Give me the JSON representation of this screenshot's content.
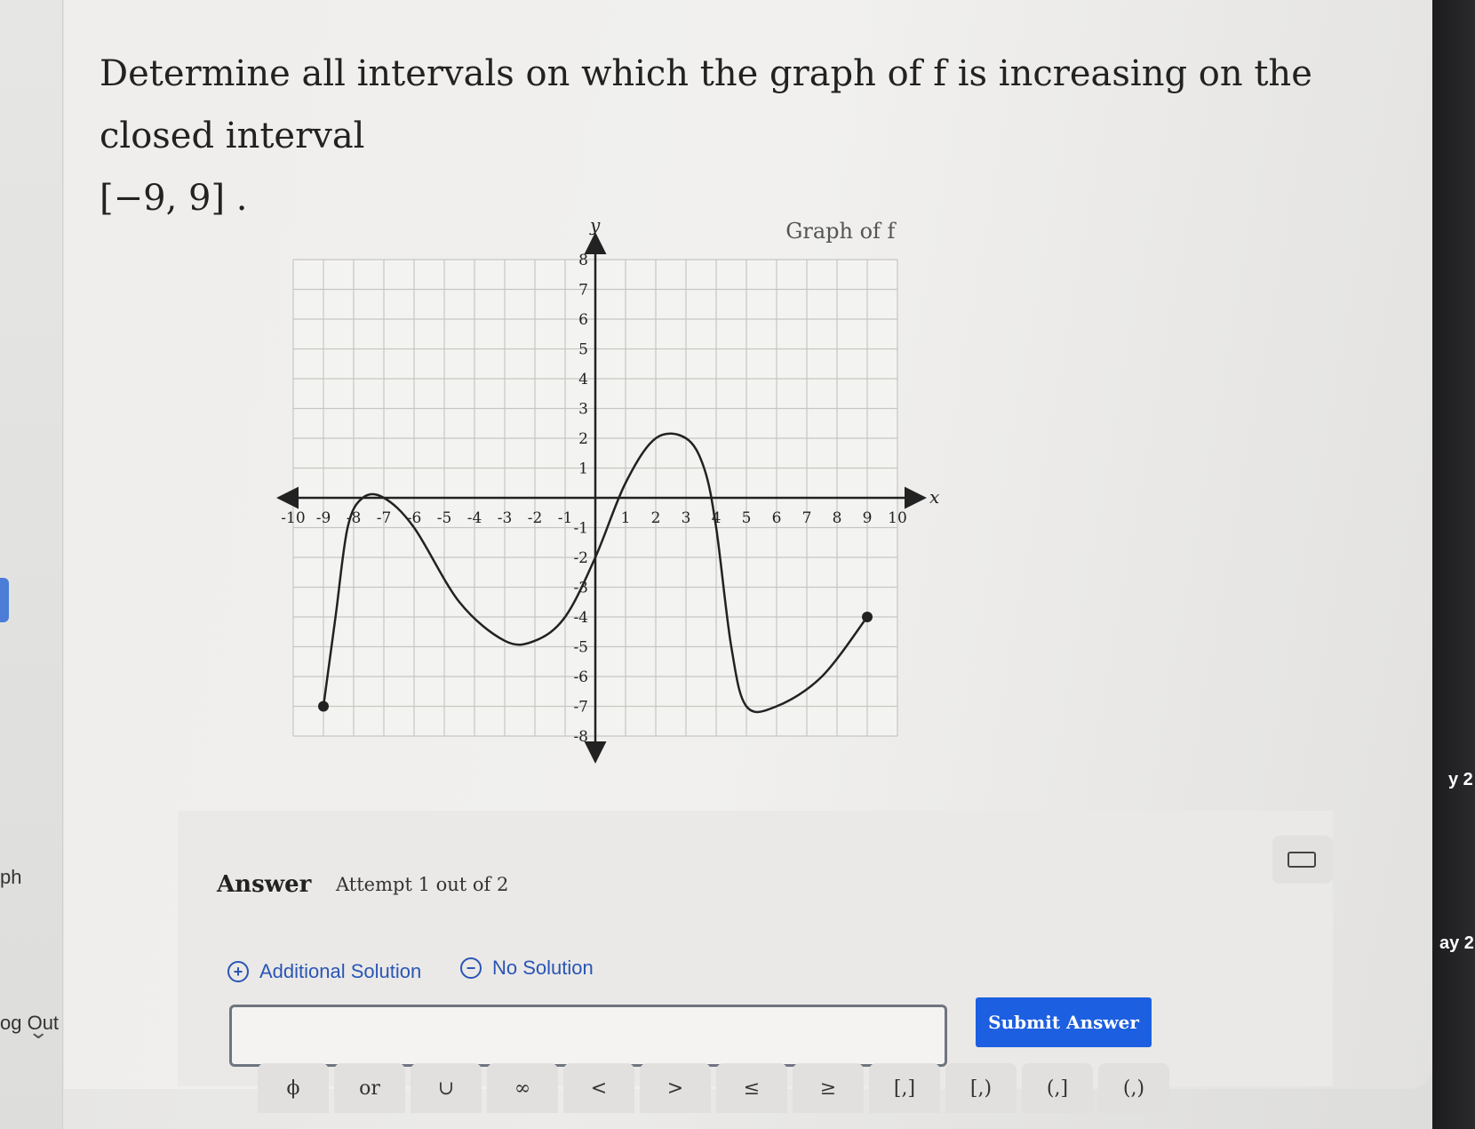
{
  "question": {
    "line1": "Determine all intervals on which the graph of f is increasing on the closed interval",
    "line2": "[−9, 9] ."
  },
  "graph": {
    "title": "Graph of f",
    "x_axis_label": "x",
    "y_axis_label": "y"
  },
  "chart_data": {
    "type": "line",
    "title": "Graph of f",
    "xlabel": "x",
    "ylabel": "y",
    "xlim": [
      -10,
      10
    ],
    "ylim": [
      -8,
      8
    ],
    "grid": true,
    "x_ticks": [
      "-10",
      "-9",
      "-8",
      "-7",
      "-6",
      "-5",
      "-4",
      "-3",
      "-2",
      "-1",
      "1",
      "2",
      "3",
      "4",
      "5",
      "6",
      "7",
      "8",
      "9",
      "10"
    ],
    "y_ticks": [
      "8",
      "7",
      "6",
      "5",
      "4",
      "3",
      "2",
      "1",
      "-1",
      "-2",
      "-3",
      "-4",
      "-5",
      "-6",
      "-7",
      "-8"
    ],
    "series": [
      {
        "points": [
          [
            -9,
            -7
          ],
          [
            -8.6,
            -4
          ],
          [
            -8.2,
            -1
          ],
          [
            -7.7,
            0
          ],
          [
            -7,
            0
          ],
          [
            -6,
            -1
          ],
          [
            -4.5,
            -3.5
          ],
          [
            -3,
            -4.8
          ],
          [
            -2,
            -4.8
          ],
          [
            -1,
            -4
          ],
          [
            0,
            -2
          ],
          [
            1,
            0.5
          ],
          [
            2,
            2
          ],
          [
            3,
            2
          ],
          [
            3.6,
            1
          ],
          [
            4,
            -1
          ],
          [
            4.5,
            -5
          ],
          [
            5,
            -7
          ],
          [
            6,
            -7
          ],
          [
            7.5,
            -6
          ],
          [
            9,
            -4
          ]
        ],
        "endpoints": [
          [
            -9,
            -7
          ],
          [
            9,
            -4
          ]
        ]
      }
    ]
  },
  "answer": {
    "label": "Answer",
    "attempt": "Attempt 1 out of 2",
    "additional_solution": "Additional Solution",
    "no_solution": "No Solution",
    "input_value": "",
    "submit_label": "Submit Answer"
  },
  "symbols": [
    "ϕ",
    "or",
    "∪",
    "∞",
    "<",
    ">",
    "≤",
    "≥",
    "[,]",
    "[,)",
    "(,]",
    "(,)"
  ],
  "left_panel": {
    "ph": "ph",
    "log_out": "og Out"
  },
  "right_panel": {
    "y2": "y 2",
    "ay2": "ay 2"
  }
}
